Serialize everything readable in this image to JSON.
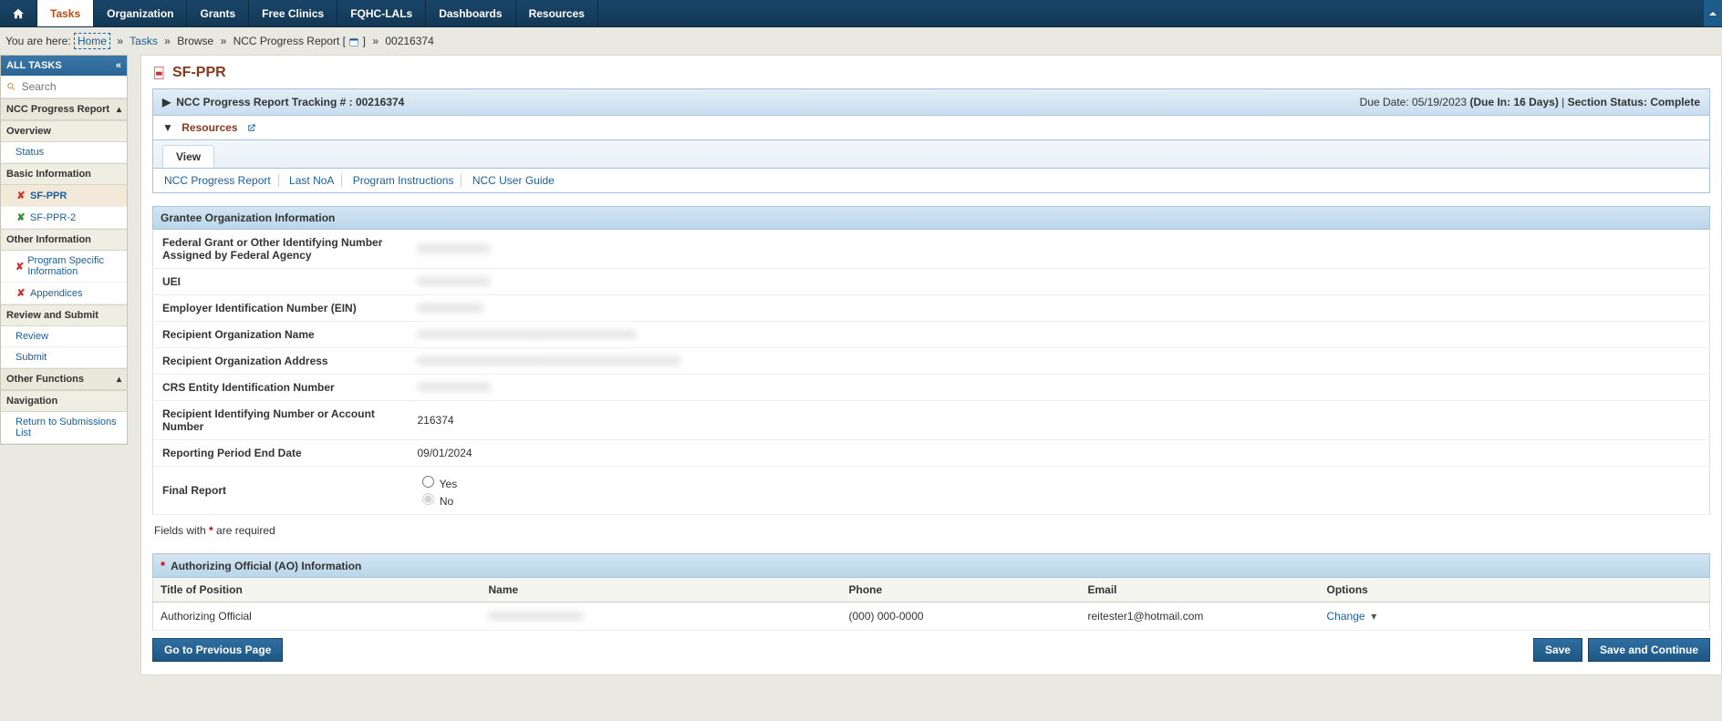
{
  "nav": {
    "items": [
      "Tasks",
      "Organization",
      "Grants",
      "Free Clinics",
      "FQHC-LALs",
      "Dashboards",
      "Resources"
    ]
  },
  "breadcrumb": {
    "prefix": "You are here:",
    "home": "Home",
    "tasks": "Tasks",
    "browse": "Browse",
    "report": "NCC Progress Report",
    "id": "00216374"
  },
  "sidebar": {
    "all_tasks": "ALL TASKS",
    "search_placeholder": "Search",
    "ncc_progress": "NCC Progress Report",
    "overview": "Overview",
    "status": "Status",
    "basic_info": "Basic Information",
    "sfppr": "SF-PPR",
    "sfppr2": "SF-PPR-2",
    "other_info": "Other Information",
    "program_specific": "Program Specific Information",
    "appendices": "Appendices",
    "review_submit": "Review and Submit",
    "review": "Review",
    "submit": "Submit",
    "other_functions": "Other Functions",
    "navigation": "Navigation",
    "return_submissions": "Return to Submissions List"
  },
  "page": {
    "title": "SF-PPR",
    "tracking": "NCC Progress Report Tracking # : 00216374",
    "due_date_label": "Due Date:",
    "due_date": "05/19/2023",
    "due_in": "(Due In: 16 Days)",
    "section_status_label": "Section Status:",
    "section_status": "Complete",
    "resources": "Resources",
    "view_tab": "View",
    "links": {
      "ncc_report": "NCC Progress Report",
      "last_noa": "Last NoA",
      "program_instructions": "Program Instructions",
      "user_guide": "NCC User Guide"
    },
    "grantee_header": "Grantee Organization Information",
    "fields": {
      "grant_number_label": "Federal Grant or Other Identifying Number Assigned by Federal Agency",
      "grant_number": "XXXXXXXXXX",
      "uei_label": "UEI",
      "uei": "XXXXXXXXXX",
      "ein_label": "Employer Identification Number (EIN)",
      "ein": "XXXXXXXXX",
      "org_name_label": "Recipient Organization Name",
      "org_name": "XXXXXXXXXXXXXXXXXXXXXXXXXXXXXX",
      "org_addr_label": "Recipient Organization Address",
      "org_addr": "XXXXXXXXXXXXXXXXXXXXXXXXXXXXXXXXXXXX",
      "crs_label": "CRS Entity Identification Number",
      "crs": "XXXXXXXXXX",
      "acct_label": "Recipient Identifying Number or Account Number",
      "acct": "216374",
      "period_label": "Reporting Period End Date",
      "period": "09/01/2024",
      "final_label": "Final Report",
      "yes": "Yes",
      "no": "No"
    },
    "required_note_pre": "Fields with",
    "required_note_post": "are required",
    "ao_header": "Authorizing Official (AO) Information",
    "ao_cols": {
      "title": "Title of Position",
      "name": "Name",
      "phone": "Phone",
      "email": "Email",
      "options": "Options"
    },
    "ao_row": {
      "title": "Authorizing Official",
      "name": "XXXXXXXXXXXXX",
      "phone": "(000) 000-0000",
      "email": "reitester1@hotmail.com",
      "change": "Change"
    },
    "buttons": {
      "prev": "Go to Previous Page",
      "save": "Save",
      "save_continue": "Save and Continue"
    }
  }
}
